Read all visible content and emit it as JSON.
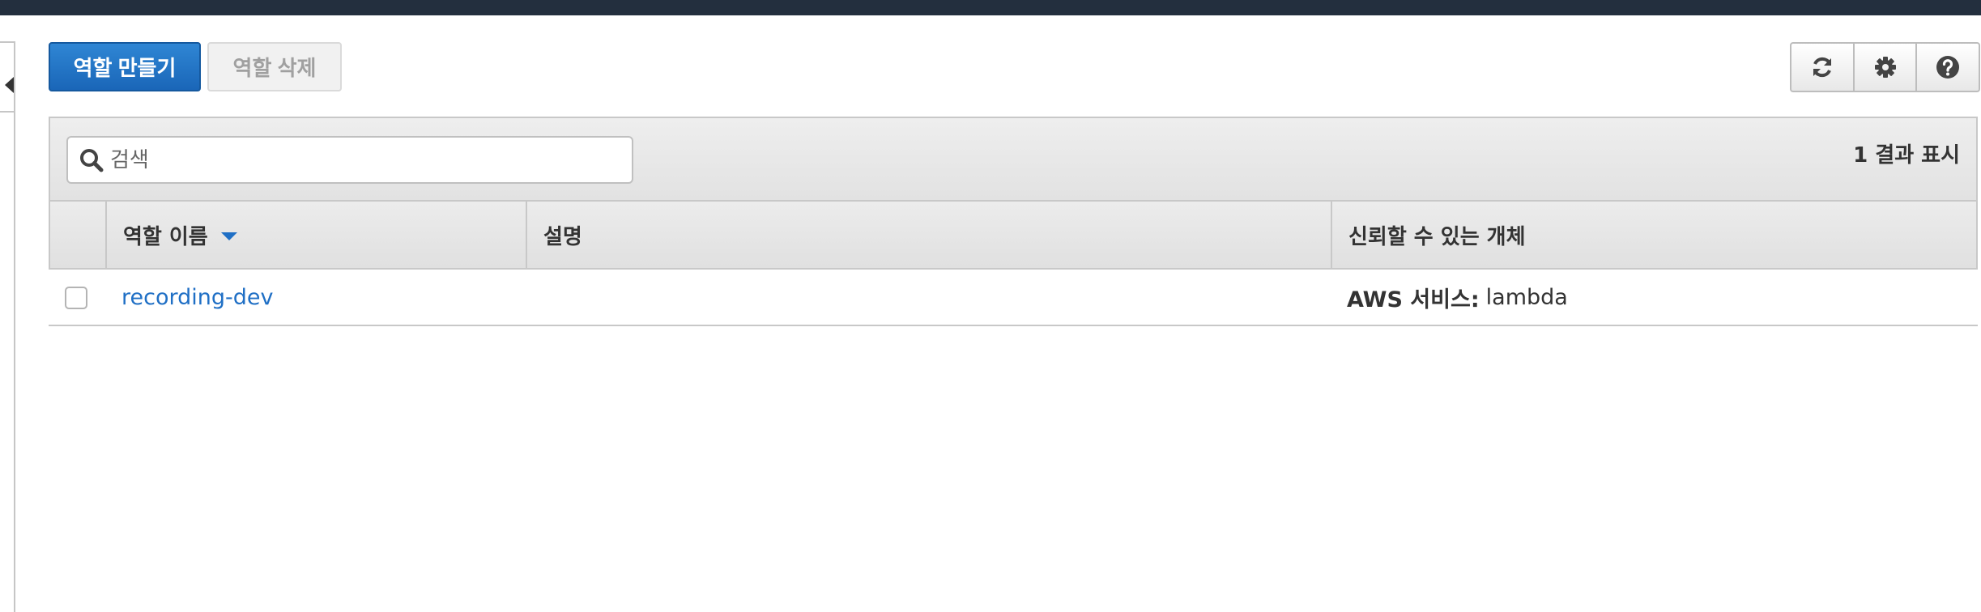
{
  "toolbar": {
    "create_label": "역할 만들기",
    "delete_label": "역할 삭제",
    "icons": [
      "refresh-icon",
      "gear-icon",
      "help-icon"
    ]
  },
  "search": {
    "placeholder": "검색"
  },
  "result_count": "1 결과 표시",
  "table": {
    "columns": [
      "역할 이름",
      "설명",
      "신뢰할 수 있는 개체"
    ],
    "rows": [
      {
        "role_name": "recording-dev",
        "description": "",
        "trusted_entity_type": "AWS 서비스:",
        "trusted_entity_value": "lambda"
      }
    ]
  },
  "colors": {
    "topbar": "#232f3e",
    "primary": "#1a66b8",
    "link": "#1f6fc5"
  }
}
